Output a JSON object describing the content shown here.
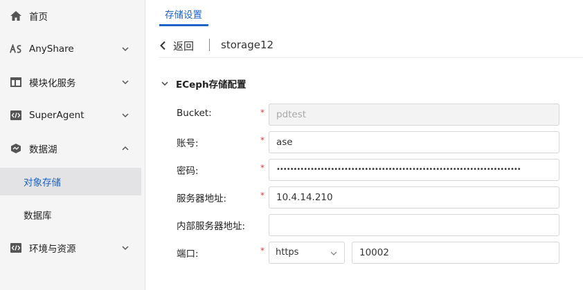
{
  "sidebar": {
    "items": [
      {
        "label": "首页",
        "icon": "home-icon"
      },
      {
        "label": "AnyShare",
        "icon": "anyshare-logo-icon"
      },
      {
        "label": "模块化服务",
        "icon": "layout-icon"
      },
      {
        "label": "SuperAgent",
        "icon": "code-icon"
      },
      {
        "label": "数据湖",
        "icon": "data-lake-icon"
      },
      {
        "label": "对象存储"
      },
      {
        "label": "数据库"
      },
      {
        "label": "环境与资源",
        "icon": "code-icon"
      }
    ]
  },
  "tabs": [
    {
      "label": "存储设置"
    }
  ],
  "header": {
    "back_label": "返回",
    "breadcrumb": "storage12"
  },
  "section": {
    "title": "ECeph存储配置"
  },
  "form": {
    "bucket": {
      "label": "Bucket:",
      "value": "pdtest",
      "required": "*"
    },
    "account": {
      "label": "账号:",
      "value": "ase",
      "required": "*"
    },
    "password": {
      "label": "密码:",
      "value": "••••••••••••••••••••••••••••••••••••••••••••••••••••••••••••••••••••••••",
      "required": "*"
    },
    "server": {
      "label": "服务器地址:",
      "value": "10.4.14.210",
      "required": "*"
    },
    "internal_server": {
      "label": "内部服务器地址:",
      "value": ""
    },
    "port": {
      "label": "端口:",
      "protocol": "https",
      "value": "10002",
      "required": "*"
    }
  },
  "colors": {
    "accent": "#1e63c7",
    "required": "#d23b3b",
    "sidebar_bg": "#f5f5f6",
    "active_bg": "#e3e3e6"
  }
}
